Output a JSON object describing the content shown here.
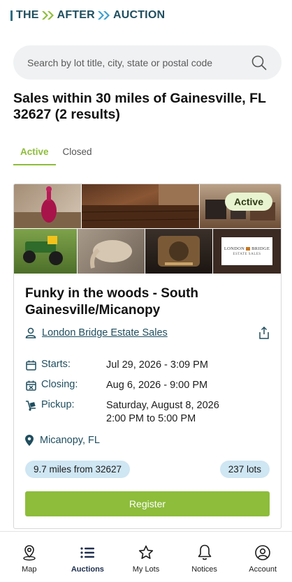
{
  "brand": {
    "logo_text_1": "THE",
    "logo_text_2": "AFTER",
    "logo_text_3": "AUCTION",
    "primary_color": "#1f4e5f",
    "accent_color": "#8dbd3a",
    "chevron_color": "#8dbd3a",
    "chevron2_color": "#3b9fd0"
  },
  "search": {
    "placeholder": "Search by lot title, city, state or postal code",
    "value": ""
  },
  "page": {
    "title": "Sales within 30 miles of Gainesville, FL 32627 (2 results)"
  },
  "tabs": [
    {
      "label": "Active",
      "selected": true
    },
    {
      "label": "Closed",
      "selected": false
    }
  ],
  "sale": {
    "status": "Active",
    "title": "Funky in the woods - South Gainesville/Micanopy",
    "seller": "London Bridge Estate Sales",
    "seller_logo_text_1": "LONDON",
    "seller_logo_text_2": "BRIDGE",
    "seller_logo_text_3": "ESTATE SALES",
    "starts_label": "Starts:",
    "starts_value": "Jul 29, 2026 - 3:09 PM",
    "closing_label": "Closing:",
    "closing_value": "Aug 6, 2026 - 9:00 PM",
    "pickup_label": "Pickup:",
    "pickup_value_line1": "Saturday, August 8, 2026",
    "pickup_value_line2": "2:00 PM to 5:00 PM",
    "location": "Micanopy, FL",
    "distance": "9.7 miles from 32627",
    "lots": "237 lots",
    "register_label": "Register"
  },
  "bottom_nav": [
    {
      "label": "Map",
      "icon": "map-pin-icon",
      "active": false
    },
    {
      "label": "Auctions",
      "icon": "list-icon",
      "active": true
    },
    {
      "label": "My Lots",
      "icon": "star-icon",
      "active": false
    },
    {
      "label": "Notices",
      "icon": "bell-icon",
      "active": false
    },
    {
      "label": "Account",
      "icon": "user-circle-icon",
      "active": false
    }
  ]
}
